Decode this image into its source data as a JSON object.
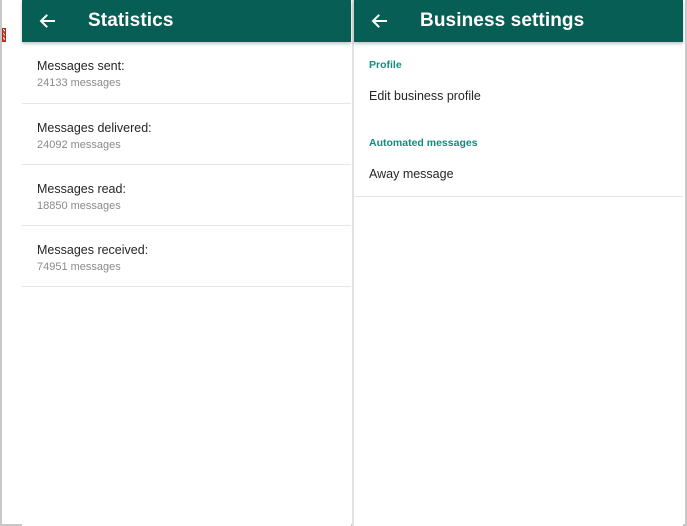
{
  "statistics": {
    "title": "Statistics",
    "items": [
      {
        "label": "Messages sent:",
        "value": "24133 messages"
      },
      {
        "label": "Messages delivered:",
        "value": "24092 messages"
      },
      {
        "label": "Messages read:",
        "value": "18850 messages"
      },
      {
        "label": "Messages received:",
        "value": "74951 messages"
      }
    ]
  },
  "business_settings": {
    "title": "Business settings",
    "sections": [
      {
        "header": "Profile",
        "items": [
          {
            "label": "Edit business profile"
          }
        ]
      },
      {
        "header": "Automated messages",
        "items": [
          {
            "label": "Away message"
          }
        ]
      }
    ]
  },
  "colors": {
    "toolbar": "#075e54",
    "accent": "#128c7e",
    "primary_text": "#262626",
    "secondary_text": "#8a8a8a",
    "divider": "#e6e6e6"
  },
  "icons": {
    "back": "arrow-left-icon"
  }
}
